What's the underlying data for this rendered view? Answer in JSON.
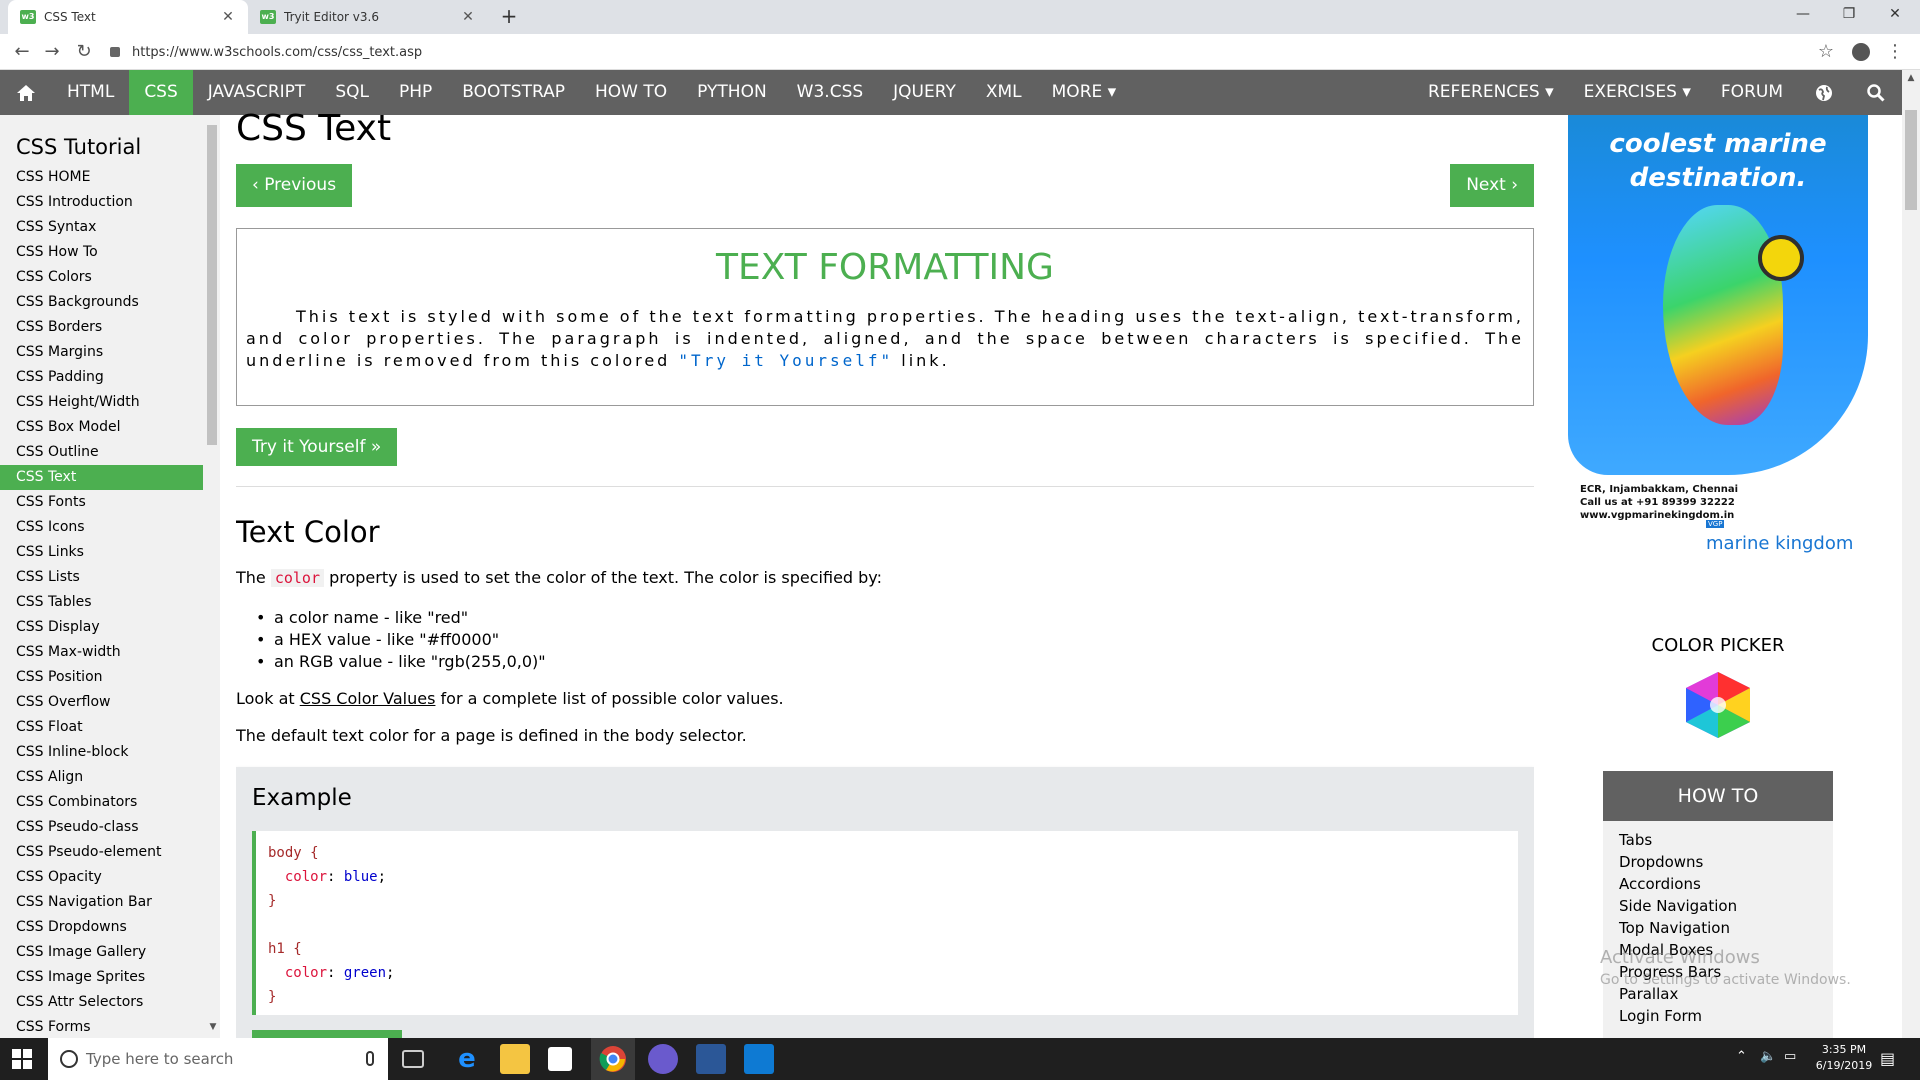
{
  "browser": {
    "tabs": [
      {
        "title": "CSS Text",
        "active": true
      },
      {
        "title": "Tryit Editor v3.6",
        "active": false
      }
    ],
    "url": "https://www.w3schools.com/css/css_text.asp"
  },
  "topnav": {
    "items": [
      "HTML",
      "CSS",
      "JAVASCRIPT",
      "SQL",
      "PHP",
      "BOOTSTRAP",
      "HOW TO",
      "PYTHON",
      "W3.CSS",
      "JQUERY",
      "XML",
      "MORE ▾"
    ],
    "active": "CSS",
    "right_items": [
      "REFERENCES ▾",
      "EXERCISES ▾",
      "FORUM"
    ]
  },
  "sidebar": {
    "title": "CSS Tutorial",
    "items": [
      "CSS HOME",
      "CSS Introduction",
      "CSS Syntax",
      "CSS How To",
      "CSS Colors",
      "CSS Backgrounds",
      "CSS Borders",
      "CSS Margins",
      "CSS Padding",
      "CSS Height/Width",
      "CSS Box Model",
      "CSS Outline",
      "CSS Text",
      "CSS Fonts",
      "CSS Icons",
      "CSS Links",
      "CSS Lists",
      "CSS Tables",
      "CSS Display",
      "CSS Max-width",
      "CSS Position",
      "CSS Overflow",
      "CSS Float",
      "CSS Inline-block",
      "CSS Align",
      "CSS Combinators",
      "CSS Pseudo-class",
      "CSS Pseudo-element",
      "CSS Opacity",
      "CSS Navigation Bar",
      "CSS Dropdowns",
      "CSS Image Gallery",
      "CSS Image Sprites",
      "CSS Attr Selectors",
      "CSS Forms"
    ],
    "active": "CSS Text"
  },
  "main": {
    "title": "CSS Text",
    "prev_label": "‹ Previous",
    "next_label": "Next ›",
    "demo": {
      "heading": "text formatting",
      "text_before": "This text is styled with some of the text formatting properties. The heading uses the text-align, text-transform, and color properties. The paragraph is indented, aligned, and the space between characters is specified. The underline is removed from this colored ",
      "link": "\"Try it Yourself\"",
      "text_after": " link."
    },
    "try_label": "Try it Yourself »",
    "section_title": "Text Color",
    "intro_before": "The ",
    "intro_code": "color",
    "intro_after": " property is used to set the color of the text. The color is specified by:",
    "bullets": [
      "a color name - like \"red\"",
      "a HEX value - like \"#ff0000\"",
      "an RGB value - like \"rgb(255,0,0)\""
    ],
    "look_before": "Look at ",
    "look_link": "CSS Color Values",
    "look_after": " for a complete list of possible color values.",
    "default_text": "The default text color for a page is defined in the body selector.",
    "example": {
      "title": "Example",
      "code": [
        {
          "sel": "body {"
        },
        {
          "prop": "color",
          "val": "blue"
        },
        {
          "sel": "}"
        },
        {
          "sel": "h1 {"
        },
        {
          "prop": "color",
          "val": "green"
        },
        {
          "sel": "}"
        }
      ]
    }
  },
  "ad": {
    "headline_line1": "coolest marine",
    "headline_line2": "destination.",
    "addr1": "ECR, Injambakkam, Chennai",
    "addr2": "Call us at +91 89399 32222",
    "addr3": "www.vgpmarinekingdom.in",
    "logo_small": "VGP",
    "logo": "marine kingdom"
  },
  "color_picker": {
    "title": "COLOR PICKER"
  },
  "howto": {
    "title": "HOW TO",
    "items": [
      "Tabs",
      "Dropdowns",
      "Accordions",
      "Side Navigation",
      "Top Navigation",
      "Modal Boxes",
      "Progress Bars",
      "Parallax",
      "Login Form"
    ]
  },
  "watermark": {
    "line1": "Activate Windows",
    "line2": "Go to Settings to activate Windows."
  },
  "taskbar": {
    "search_placeholder": "Type here to search",
    "time": "3:35 PM",
    "date": "6/19/2019"
  },
  "colors": {
    "accent": "#4caf50",
    "nav": "#616161",
    "sidebar": "#f1f1f1"
  }
}
